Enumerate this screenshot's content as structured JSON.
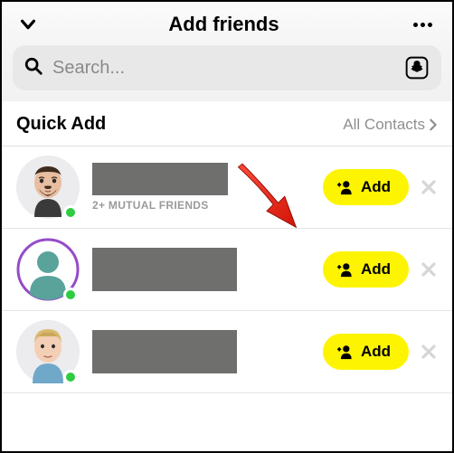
{
  "header": {
    "title": "Add friends"
  },
  "search": {
    "placeholder": "Search..."
  },
  "section": {
    "title": "Quick Add",
    "link": "All Contacts"
  },
  "buttons": {
    "add_label": "Add"
  },
  "rows": [
    {
      "name_redacted": true,
      "mutual_text": "2+ MUTUAL FRIENDS",
      "avatar_type": "bitmoji-beard",
      "has_story_ring": false,
      "online": true
    },
    {
      "name_redacted": true,
      "mutual_text": "",
      "avatar_type": "silhouette",
      "has_story_ring": true,
      "online": true
    },
    {
      "name_redacted": true,
      "mutual_text": "",
      "avatar_type": "bitmoji-blond",
      "has_story_ring": false,
      "online": true
    }
  ],
  "colors": {
    "accent": "#fdf402",
    "story_ring": "#8b3fc9",
    "online": "#2ecc40"
  }
}
